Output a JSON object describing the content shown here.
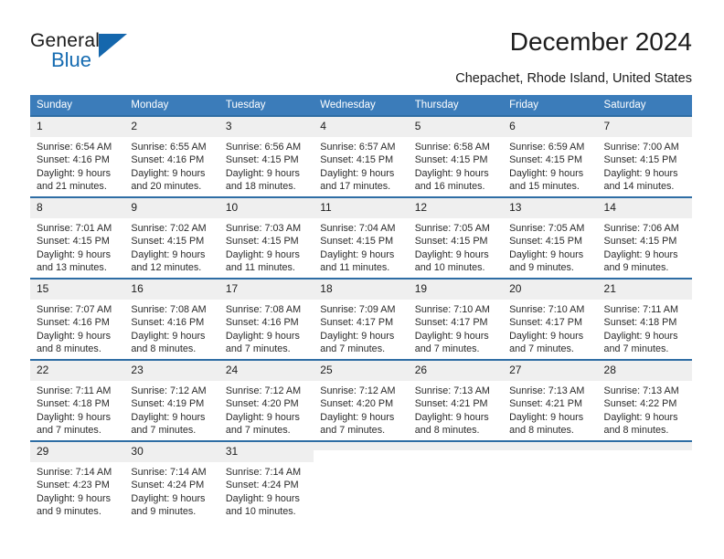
{
  "brand": {
    "name_part1": "General",
    "name_part2": "Blue",
    "flag_icon": "blue-triangle-flag",
    "accent_color": "#1567ad"
  },
  "header": {
    "title": "December 2024",
    "subtitle": "Chepachet, Rhode Island, United States"
  },
  "calendar": {
    "header_bg": "#3b7cba",
    "header_text_color": "#ffffff",
    "row_divider_color": "#2e6da4",
    "daynum_bg": "#efefef",
    "weekday_headers": [
      "Sunday",
      "Monday",
      "Tuesday",
      "Wednesday",
      "Thursday",
      "Friday",
      "Saturday"
    ],
    "weeks": [
      [
        {
          "day": "1",
          "sunrise": "Sunrise: 6:54 AM",
          "sunset": "Sunset: 4:16 PM",
          "daylight_line1": "Daylight: 9 hours",
          "daylight_line2": "and 21 minutes."
        },
        {
          "day": "2",
          "sunrise": "Sunrise: 6:55 AM",
          "sunset": "Sunset: 4:16 PM",
          "daylight_line1": "Daylight: 9 hours",
          "daylight_line2": "and 20 minutes."
        },
        {
          "day": "3",
          "sunrise": "Sunrise: 6:56 AM",
          "sunset": "Sunset: 4:15 PM",
          "daylight_line1": "Daylight: 9 hours",
          "daylight_line2": "and 18 minutes."
        },
        {
          "day": "4",
          "sunrise": "Sunrise: 6:57 AM",
          "sunset": "Sunset: 4:15 PM",
          "daylight_line1": "Daylight: 9 hours",
          "daylight_line2": "and 17 minutes."
        },
        {
          "day": "5",
          "sunrise": "Sunrise: 6:58 AM",
          "sunset": "Sunset: 4:15 PM",
          "daylight_line1": "Daylight: 9 hours",
          "daylight_line2": "and 16 minutes."
        },
        {
          "day": "6",
          "sunrise": "Sunrise: 6:59 AM",
          "sunset": "Sunset: 4:15 PM",
          "daylight_line1": "Daylight: 9 hours",
          "daylight_line2": "and 15 minutes."
        },
        {
          "day": "7",
          "sunrise": "Sunrise: 7:00 AM",
          "sunset": "Sunset: 4:15 PM",
          "daylight_line1": "Daylight: 9 hours",
          "daylight_line2": "and 14 minutes."
        }
      ],
      [
        {
          "day": "8",
          "sunrise": "Sunrise: 7:01 AM",
          "sunset": "Sunset: 4:15 PM",
          "daylight_line1": "Daylight: 9 hours",
          "daylight_line2": "and 13 minutes."
        },
        {
          "day": "9",
          "sunrise": "Sunrise: 7:02 AM",
          "sunset": "Sunset: 4:15 PM",
          "daylight_line1": "Daylight: 9 hours",
          "daylight_line2": "and 12 minutes."
        },
        {
          "day": "10",
          "sunrise": "Sunrise: 7:03 AM",
          "sunset": "Sunset: 4:15 PM",
          "daylight_line1": "Daylight: 9 hours",
          "daylight_line2": "and 11 minutes."
        },
        {
          "day": "11",
          "sunrise": "Sunrise: 7:04 AM",
          "sunset": "Sunset: 4:15 PM",
          "daylight_line1": "Daylight: 9 hours",
          "daylight_line2": "and 11 minutes."
        },
        {
          "day": "12",
          "sunrise": "Sunrise: 7:05 AM",
          "sunset": "Sunset: 4:15 PM",
          "daylight_line1": "Daylight: 9 hours",
          "daylight_line2": "and 10 minutes."
        },
        {
          "day": "13",
          "sunrise": "Sunrise: 7:05 AM",
          "sunset": "Sunset: 4:15 PM",
          "daylight_line1": "Daylight: 9 hours",
          "daylight_line2": "and 9 minutes."
        },
        {
          "day": "14",
          "sunrise": "Sunrise: 7:06 AM",
          "sunset": "Sunset: 4:15 PM",
          "daylight_line1": "Daylight: 9 hours",
          "daylight_line2": "and 9 minutes."
        }
      ],
      [
        {
          "day": "15",
          "sunrise": "Sunrise: 7:07 AM",
          "sunset": "Sunset: 4:16 PM",
          "daylight_line1": "Daylight: 9 hours",
          "daylight_line2": "and 8 minutes."
        },
        {
          "day": "16",
          "sunrise": "Sunrise: 7:08 AM",
          "sunset": "Sunset: 4:16 PM",
          "daylight_line1": "Daylight: 9 hours",
          "daylight_line2": "and 8 minutes."
        },
        {
          "day": "17",
          "sunrise": "Sunrise: 7:08 AM",
          "sunset": "Sunset: 4:16 PM",
          "daylight_line1": "Daylight: 9 hours",
          "daylight_line2": "and 7 minutes."
        },
        {
          "day": "18",
          "sunrise": "Sunrise: 7:09 AM",
          "sunset": "Sunset: 4:17 PM",
          "daylight_line1": "Daylight: 9 hours",
          "daylight_line2": "and 7 minutes."
        },
        {
          "day": "19",
          "sunrise": "Sunrise: 7:10 AM",
          "sunset": "Sunset: 4:17 PM",
          "daylight_line1": "Daylight: 9 hours",
          "daylight_line2": "and 7 minutes."
        },
        {
          "day": "20",
          "sunrise": "Sunrise: 7:10 AM",
          "sunset": "Sunset: 4:17 PM",
          "daylight_line1": "Daylight: 9 hours",
          "daylight_line2": "and 7 minutes."
        },
        {
          "day": "21",
          "sunrise": "Sunrise: 7:11 AM",
          "sunset": "Sunset: 4:18 PM",
          "daylight_line1": "Daylight: 9 hours",
          "daylight_line2": "and 7 minutes."
        }
      ],
      [
        {
          "day": "22",
          "sunrise": "Sunrise: 7:11 AM",
          "sunset": "Sunset: 4:18 PM",
          "daylight_line1": "Daylight: 9 hours",
          "daylight_line2": "and 7 minutes."
        },
        {
          "day": "23",
          "sunrise": "Sunrise: 7:12 AM",
          "sunset": "Sunset: 4:19 PM",
          "daylight_line1": "Daylight: 9 hours",
          "daylight_line2": "and 7 minutes."
        },
        {
          "day": "24",
          "sunrise": "Sunrise: 7:12 AM",
          "sunset": "Sunset: 4:20 PM",
          "daylight_line1": "Daylight: 9 hours",
          "daylight_line2": "and 7 minutes."
        },
        {
          "day": "25",
          "sunrise": "Sunrise: 7:12 AM",
          "sunset": "Sunset: 4:20 PM",
          "daylight_line1": "Daylight: 9 hours",
          "daylight_line2": "and 7 minutes."
        },
        {
          "day": "26",
          "sunrise": "Sunrise: 7:13 AM",
          "sunset": "Sunset: 4:21 PM",
          "daylight_line1": "Daylight: 9 hours",
          "daylight_line2": "and 8 minutes."
        },
        {
          "day": "27",
          "sunrise": "Sunrise: 7:13 AM",
          "sunset": "Sunset: 4:21 PM",
          "daylight_line1": "Daylight: 9 hours",
          "daylight_line2": "and 8 minutes."
        },
        {
          "day": "28",
          "sunrise": "Sunrise: 7:13 AM",
          "sunset": "Sunset: 4:22 PM",
          "daylight_line1": "Daylight: 9 hours",
          "daylight_line2": "and 8 minutes."
        }
      ],
      [
        {
          "day": "29",
          "sunrise": "Sunrise: 7:14 AM",
          "sunset": "Sunset: 4:23 PM",
          "daylight_line1": "Daylight: 9 hours",
          "daylight_line2": "and 9 minutes."
        },
        {
          "day": "30",
          "sunrise": "Sunrise: 7:14 AM",
          "sunset": "Sunset: 4:24 PM",
          "daylight_line1": "Daylight: 9 hours",
          "daylight_line2": "and 9 minutes."
        },
        {
          "day": "31",
          "sunrise": "Sunrise: 7:14 AM",
          "sunset": "Sunset: 4:24 PM",
          "daylight_line1": "Daylight: 9 hours",
          "daylight_line2": "and 10 minutes."
        },
        {
          "day": "",
          "sunrise": "",
          "sunset": "",
          "daylight_line1": "",
          "daylight_line2": ""
        },
        {
          "day": "",
          "sunrise": "",
          "sunset": "",
          "daylight_line1": "",
          "daylight_line2": ""
        },
        {
          "day": "",
          "sunrise": "",
          "sunset": "",
          "daylight_line1": "",
          "daylight_line2": ""
        },
        {
          "day": "",
          "sunrise": "",
          "sunset": "",
          "daylight_line1": "",
          "daylight_line2": ""
        }
      ]
    ]
  }
}
